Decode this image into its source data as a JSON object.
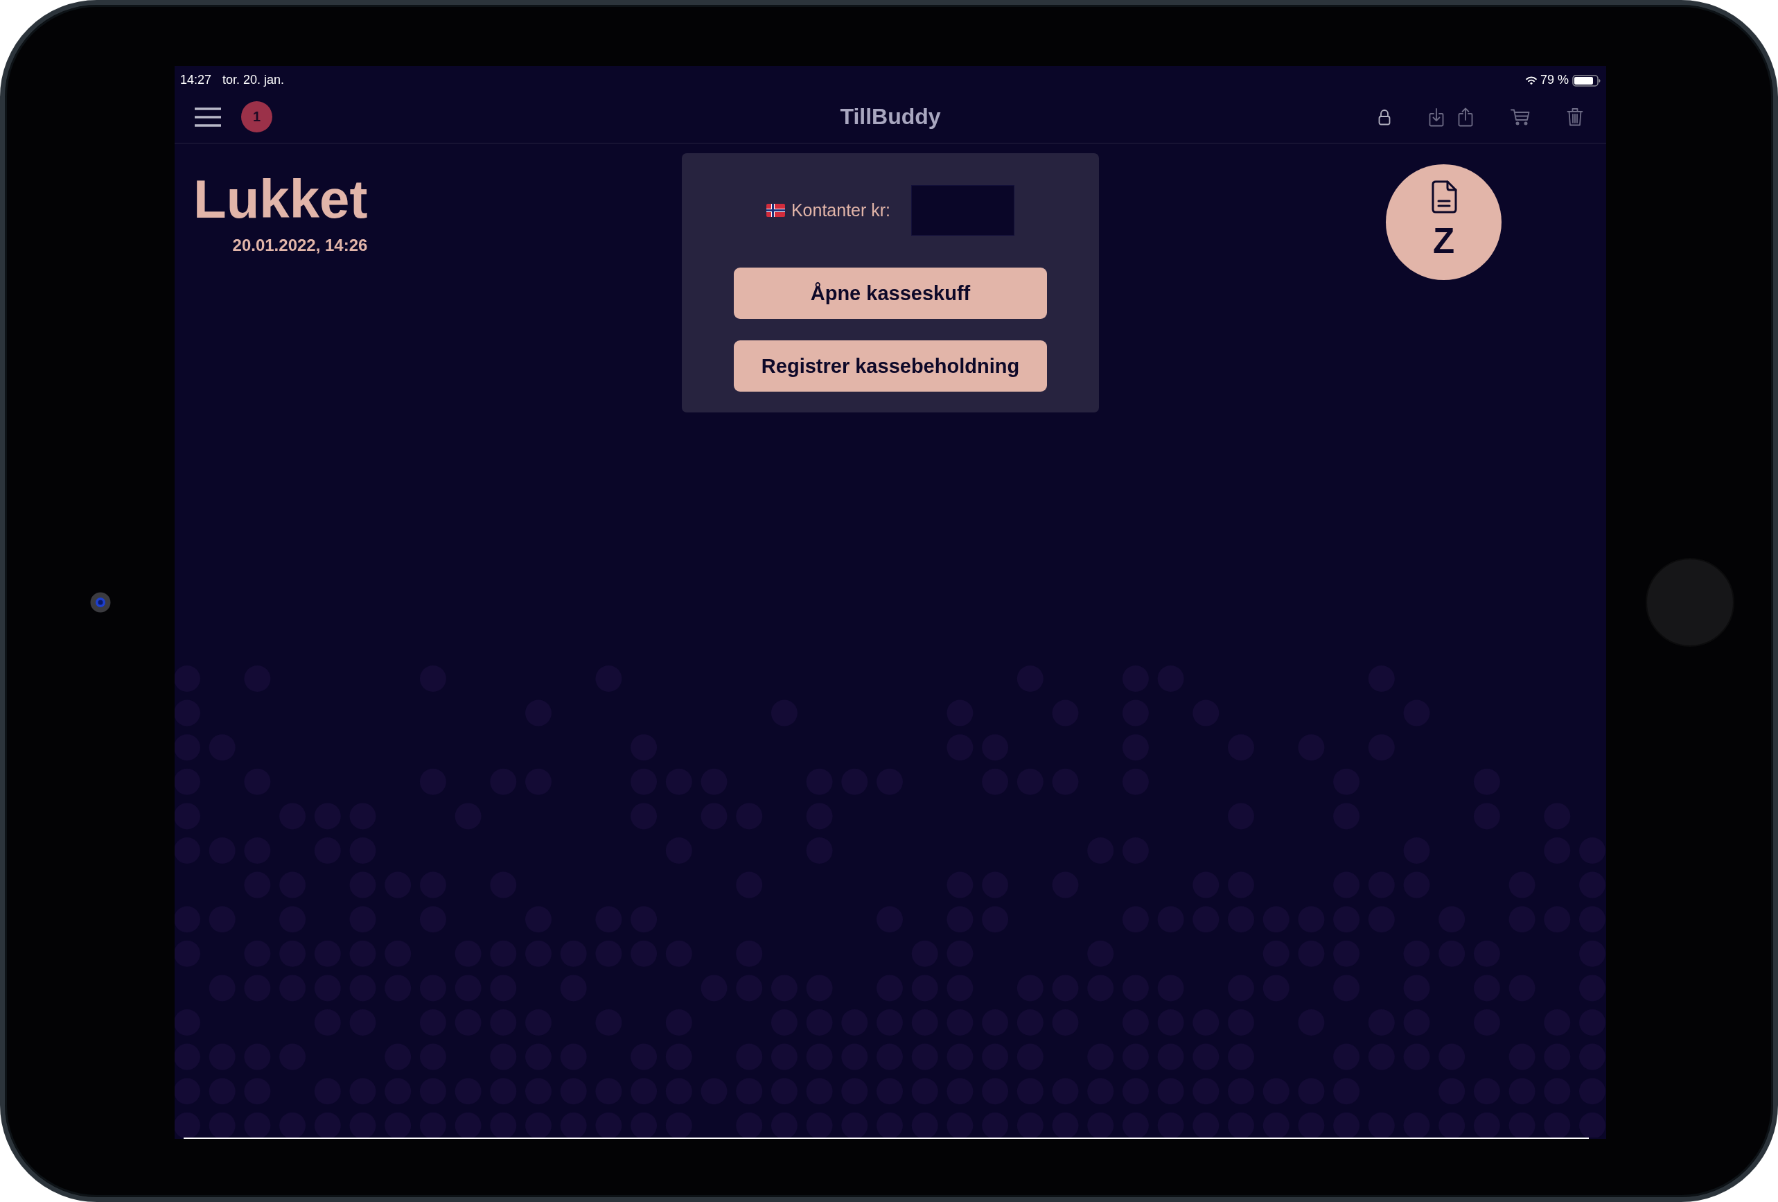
{
  "status_bar": {
    "time": "14:27",
    "date": "tor. 20. jan.",
    "battery": "79 %"
  },
  "nav_bar": {
    "badge": "1",
    "title": "TillBuddy",
    "toolbar": [
      {
        "kind": "lock",
        "disabled": false
      },
      {
        "kind": "download",
        "disabled": true
      },
      {
        "kind": "share",
        "disabled": true
      },
      {
        "kind": "cart",
        "disabled": true
      },
      {
        "kind": "trash",
        "disabled": true
      }
    ]
  },
  "register_status": {
    "title": "Lukket",
    "timestamp": "20.01.2022, 14:26"
  },
  "cash_panel": {
    "label": "Kontanter kr:",
    "buttons": [
      {
        "label": "Åpne kasseskuff"
      },
      {
        "label": "Registrer kassebeholdning"
      }
    ]
  },
  "z_report_button": {
    "label": "Z"
  }
}
